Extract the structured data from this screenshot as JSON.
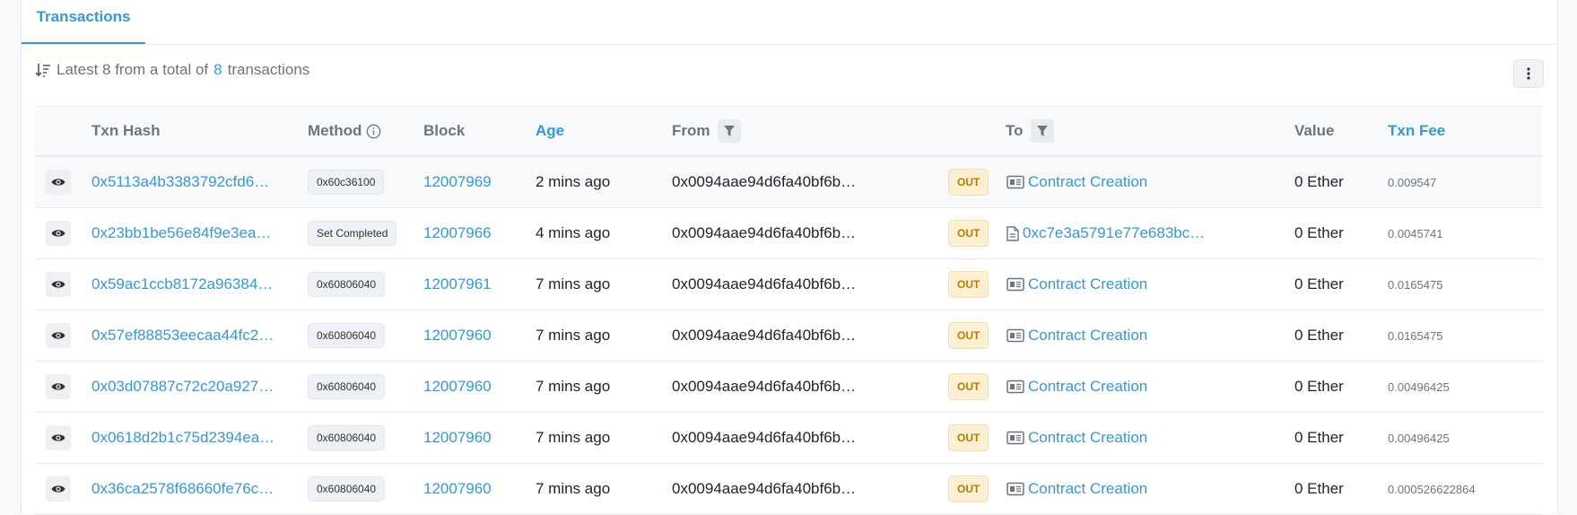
{
  "tabs": {
    "active": "Transactions"
  },
  "summary": {
    "prefix": "Latest 8 from a total of",
    "count": "8",
    "suffix": "transactions"
  },
  "columns": {
    "txn_hash": "Txn Hash",
    "method": "Method",
    "block": "Block",
    "age": "Age",
    "from": "From",
    "to": "To",
    "value": "Value",
    "txn_fee": "Txn Fee"
  },
  "rows": [
    {
      "hash": "0x5113a4b3383792cfd6…",
      "method": "0x60c36100",
      "block": "12007969",
      "age": "2 mins ago",
      "from": "0x0094aae94d6fa40bf6b…",
      "direction": "OUT",
      "to_type": "contract",
      "to": "Contract Creation",
      "value": "0 Ether",
      "fee": "0.009547"
    },
    {
      "hash": "0x23bb1be56e84f9e3ea…",
      "method": "Set Completed",
      "block": "12007966",
      "age": "4 mins ago",
      "from": "0x0094aae94d6fa40bf6b…",
      "direction": "OUT",
      "to_type": "address",
      "to": "0xc7e3a5791e77e683bc…",
      "value": "0 Ether",
      "fee": "0.0045741"
    },
    {
      "hash": "0x59ac1ccb8172a96384…",
      "method": "0x60806040",
      "block": "12007961",
      "age": "7 mins ago",
      "from": "0x0094aae94d6fa40bf6b…",
      "direction": "OUT",
      "to_type": "contract",
      "to": "Contract Creation",
      "value": "0 Ether",
      "fee": "0.0165475"
    },
    {
      "hash": "0x57ef88853eecaa44fc2…",
      "method": "0x60806040",
      "block": "12007960",
      "age": "7 mins ago",
      "from": "0x0094aae94d6fa40bf6b…",
      "direction": "OUT",
      "to_type": "contract",
      "to": "Contract Creation",
      "value": "0 Ether",
      "fee": "0.0165475"
    },
    {
      "hash": "0x03d07887c72c20a927…",
      "method": "0x60806040",
      "block": "12007960",
      "age": "7 mins ago",
      "from": "0x0094aae94d6fa40bf6b…",
      "direction": "OUT",
      "to_type": "contract",
      "to": "Contract Creation",
      "value": "0 Ether",
      "fee": "0.00496425"
    },
    {
      "hash": "0x0618d2b1c75d2394ea…",
      "method": "0x60806040",
      "block": "12007960",
      "age": "7 mins ago",
      "from": "0x0094aae94d6fa40bf6b…",
      "direction": "OUT",
      "to_type": "contract",
      "to": "Contract Creation",
      "value": "0 Ether",
      "fee": "0.00496425"
    },
    {
      "hash": "0x36ca2578f68660fe76c…",
      "method": "0x60806040",
      "block": "12007960",
      "age": "7 mins ago",
      "from": "0x0094aae94d6fa40bf6b…",
      "direction": "OUT",
      "to_type": "contract",
      "to": "Contract Creation",
      "value": "0 Ether",
      "fee": "0.000526622864"
    }
  ],
  "icons": {
    "sort": "sort-desc-icon",
    "more": "vertical-dots-icon",
    "info": "info-circle-icon",
    "filter": "filter-icon",
    "eye": "eye-icon",
    "contract": "contract-creation-icon",
    "document": "document-icon"
  },
  "colors": {
    "link": "#3498db",
    "out_bg": "#fcefd2",
    "out_text": "#b47d00"
  }
}
